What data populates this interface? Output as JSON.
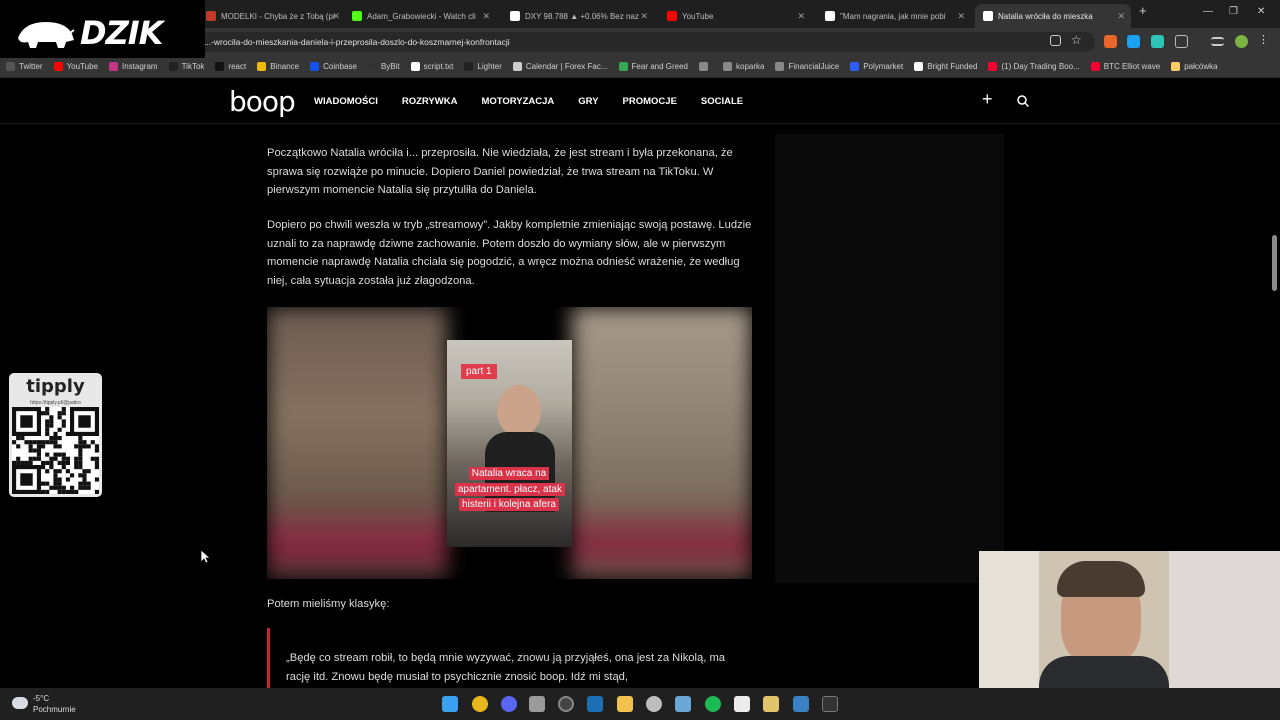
{
  "browser": {
    "tabs": [
      {
        "label": "MODELKI - Chyba że z Tobą (pr",
        "color": "#c0392b"
      },
      {
        "label": "Adam_Grabowiecki - Watch cli",
        "color": "#53fc18"
      },
      {
        "label": "DXY 98.788 ▲ +0.06% Bez naz",
        "color": "#ffffff"
      },
      {
        "label": "YouTube",
        "color": "#ff0000"
      },
      {
        "label": "\"Mam nagrania, jak mnie pobi",
        "color": "#ffffff"
      },
      {
        "label": "Natalia wróciła do mieszka",
        "color": "#ffffff"
      }
    ],
    "url": "...-wrocila-do-mieszkania-daniela-i-przeprosila-doszlo-do-koszmarnej-konfrontacji",
    "bookmarks": [
      {
        "label": "Twitter",
        "color": "#555555"
      },
      {
        "label": "YouTube",
        "color": "#ff0000"
      },
      {
        "label": "Instagram",
        "color": "#c13584"
      },
      {
        "label": "TikTok",
        "color": "#222222"
      },
      {
        "label": "react",
        "color": "#111111"
      },
      {
        "label": "Binance",
        "color": "#f0b90b"
      },
      {
        "label": "Coinbase",
        "color": "#1652f0"
      },
      {
        "label": "ByBit",
        "color": "#333333"
      },
      {
        "label": "script.txt",
        "color": "#ffffff"
      },
      {
        "label": "Lighter",
        "color": "#222222"
      },
      {
        "label": "Calendar | Forex Fac...",
        "color": "#cccccc"
      },
      {
        "label": "Fear and Greed",
        "color": "#34a853"
      },
      {
        "label": "",
        "color": "#888888"
      },
      {
        "label": "koparka",
        "color": "#888888"
      },
      {
        "label": "FinancialJuice",
        "color": "#888888"
      },
      {
        "label": "Polymarket",
        "color": "#2d5bff"
      },
      {
        "label": "Bright Funded",
        "color": "#ffffff"
      },
      {
        "label": "(1) Day Trading Boo...",
        "color": "#ff0033"
      },
      {
        "label": "BTC Elliot wave",
        "color": "#ff0033"
      },
      {
        "label": "pałcówka",
        "color": "#ffcc66"
      }
    ]
  },
  "overlay": {
    "dzik_logo": "DZIK"
  },
  "site": {
    "logo": "boop",
    "nav": [
      "WIADOMOŚCI",
      "ROZRYWKA",
      "MOTORYZACJA",
      "GRY",
      "PROMOCJE",
      "SOCIALE"
    ]
  },
  "article": {
    "p1": "Początkowo Natalia wróciła i... przeprosiła. Nie wiedziała, że jest stream i była przekonana, że sprawa się rozwiąże po minucie. Dopiero Daniel powiedział, że trwa stream na TikToku. W pierwszym momencie Natalia się przytuliła do Daniela.",
    "p2": "Dopiero po chwili weszła w tryb „streamowy”. Jakby kompletnie zmieniając swoją postawę. Ludzie uznali to za naprawdę dziwne zachowanie. Potem doszło do wymiany słów, ale w pierwszym momencie naprawdę Natalia chciała się pogodzić, a wręcz można odnieść wrażenie, że według niej, cała sytuacja została już złagodzona.",
    "video_badge": "part 1",
    "video_caption": "Natalia wraca na apartament. płacz, atak histerii i kolejna afera",
    "p3": "Potem mieliśmy klasykę:",
    "quote": "„Będę co stream robił, to będą mnie wyzywać, znowu ją przyjąłeś, ona jest za Nikolą, ma rację itd. Znowu będę musiał to psychicznie znosić boop. Idź mi stąd,"
  },
  "tipply": {
    "brand": "tipply",
    "url": "https://tipply.pl/@patiro"
  },
  "taskbar": {
    "weather_temp": "-5°C",
    "weather_desc": "Pochmurnie"
  }
}
